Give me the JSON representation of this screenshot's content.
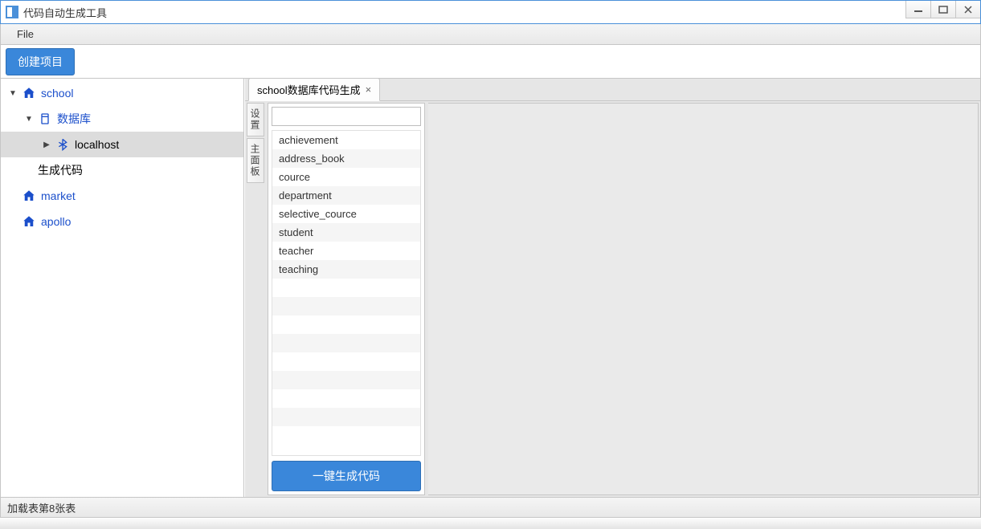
{
  "window": {
    "title": "代码自动生成工具"
  },
  "menubar": {
    "file": "File"
  },
  "toolbar": {
    "create_project": "创建项目"
  },
  "tree": {
    "items": [
      {
        "label": "school",
        "icon": "home",
        "depth": 0,
        "arrow": "expanded",
        "blue": true
      },
      {
        "label": "数据库",
        "icon": "db",
        "depth": 1,
        "arrow": "expanded",
        "blue": true
      },
      {
        "label": "localhost",
        "icon": "bt",
        "depth": 2,
        "arrow": "collapsed",
        "blue": false,
        "selected": true
      },
      {
        "label": "生成代码",
        "icon": "none",
        "depth": 1,
        "arrow": "none",
        "blue": false
      },
      {
        "label": "market",
        "icon": "home",
        "depth": 0,
        "arrow": "none",
        "blue": true
      },
      {
        "label": "apollo",
        "icon": "home",
        "depth": 0,
        "arrow": "none",
        "blue": true
      }
    ]
  },
  "editor": {
    "tab_label": "school数据库代码生成",
    "side_tabs": {
      "settings": "设置",
      "main_panel": "主面板"
    },
    "search_placeholder": "",
    "tables": [
      "achievement",
      "address_book",
      "cource",
      "department",
      "selective_cource",
      "student",
      "teacher",
      "teaching"
    ],
    "generate_btn": "一键生成代码"
  },
  "statusbar": {
    "text": "加载表第8张表"
  }
}
